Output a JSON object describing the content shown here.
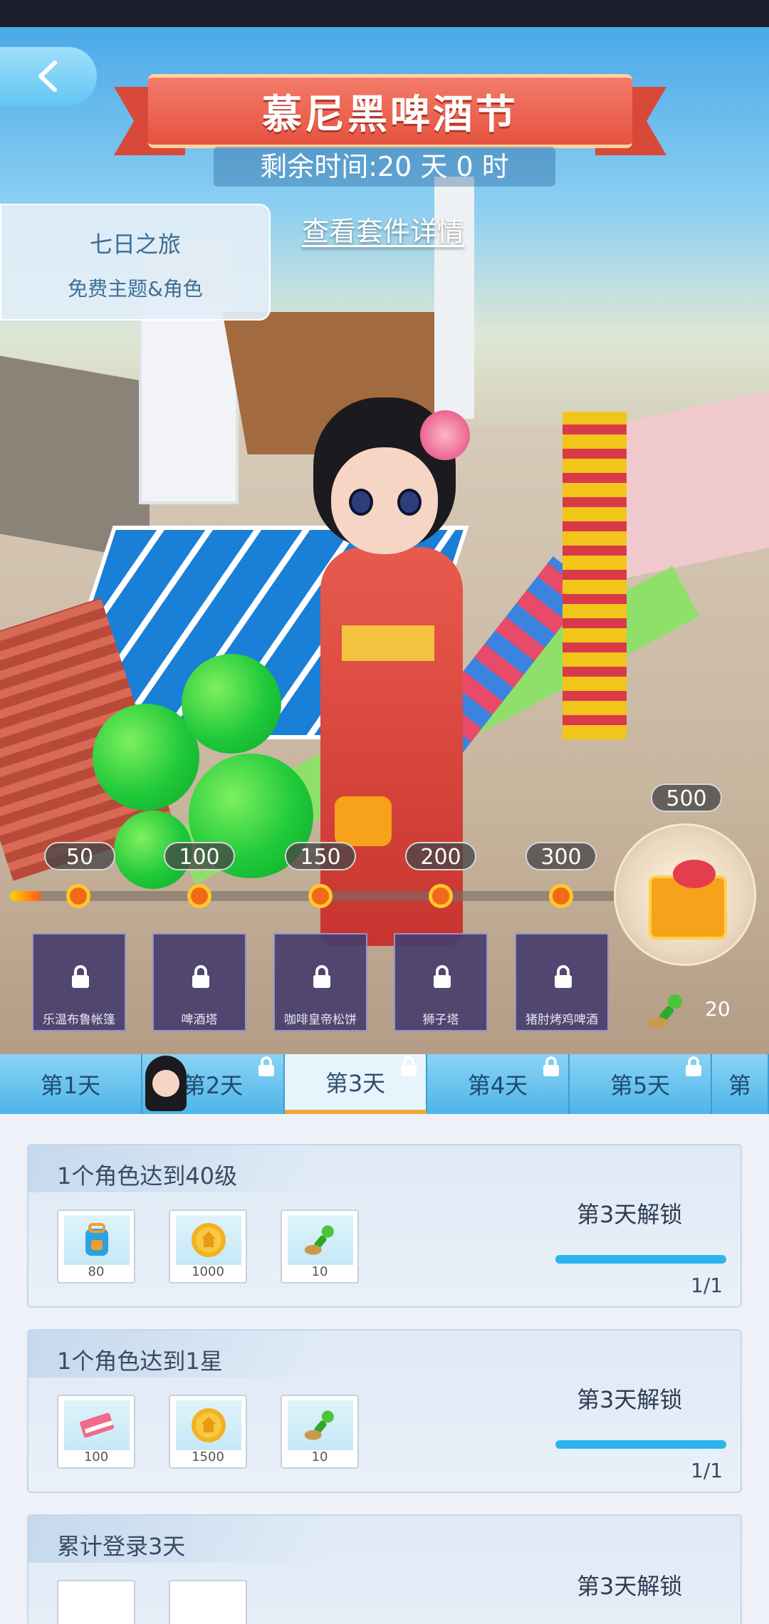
{
  "header": {
    "title": "慕尼黑啤酒节",
    "countdown": "剩余时间:20 天 0 时",
    "view_details": "查看套件详情"
  },
  "promo": {
    "title": "七日之旅",
    "subtitle": "免费主题&角色"
  },
  "milestones": {
    "points": [
      "50",
      "100",
      "150",
      "200",
      "300"
    ],
    "final": "500",
    "progress_value": 20,
    "accent_color": "#f06a1a"
  },
  "rewards": [
    {
      "name": "乐温布鲁帐篷",
      "locked": true
    },
    {
      "name": "啤酒塔",
      "locked": true
    },
    {
      "name": "咖啡皇帝松饼",
      "locked": true
    },
    {
      "name": "狮子塔",
      "locked": true
    },
    {
      "name": "猪肘烤鸡啤酒",
      "locked": true
    }
  ],
  "stamp_counter": "20",
  "tabs": [
    {
      "label": "第1天",
      "locked": false
    },
    {
      "label": "第2天",
      "locked": true
    },
    {
      "label": "第3天",
      "locked": true,
      "active": true
    },
    {
      "label": "第4天",
      "locked": true
    },
    {
      "label": "第5天",
      "locked": true
    },
    {
      "label": "第",
      "locked": false
    }
  ],
  "tasks": [
    {
      "title": "1个角色达到40级",
      "items": [
        {
          "icon": "backpack-icon",
          "qty": "80"
        },
        {
          "icon": "gold-coin-icon",
          "qty": "1000"
        },
        {
          "icon": "green-stamp-icon",
          "qty": "10"
        }
      ],
      "status": "第3天解锁",
      "progress": "1/1"
    },
    {
      "title": "1个角色达到1星",
      "items": [
        {
          "icon": "book-icon",
          "qty": "100"
        },
        {
          "icon": "gold-coin-icon",
          "qty": "1500"
        },
        {
          "icon": "green-stamp-icon",
          "qty": "10"
        }
      ],
      "status": "第3天解锁",
      "progress": "1/1"
    },
    {
      "title": "累计登录3天",
      "status": "第3天解锁"
    }
  ]
}
